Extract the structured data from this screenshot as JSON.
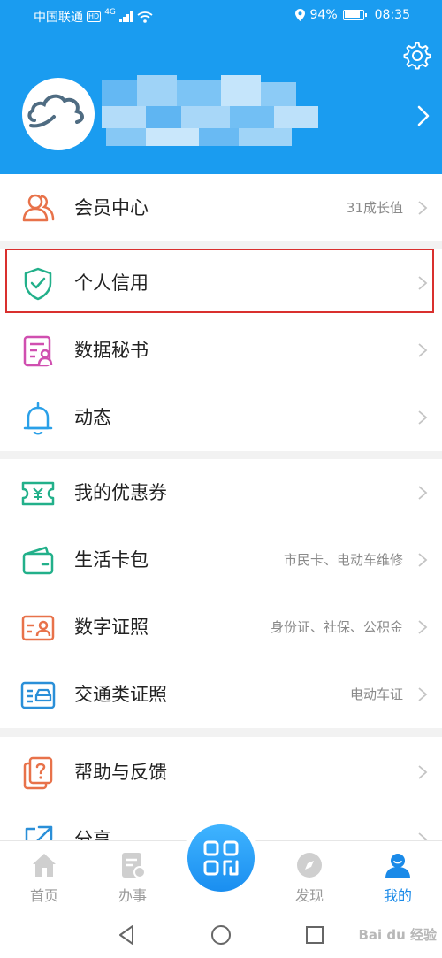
{
  "status_bar": {
    "carrier": "中国联通",
    "network": "4G",
    "battery": "94%",
    "time": "08:35"
  },
  "menu": {
    "group1": [
      {
        "name": "member-center",
        "title": "会员中心",
        "subtitle": "31成长值",
        "icon": "members-icon",
        "color": "#e8724a"
      },
      {
        "name": "personal-credit",
        "title": "个人信用",
        "subtitle": "",
        "icon": "shield-check-icon",
        "color": "#22b08a"
      },
      {
        "name": "data-secretary",
        "title": "数据秘书",
        "subtitle": "",
        "icon": "document-person-icon",
        "color": "#d04fb0"
      },
      {
        "name": "activity",
        "title": "动态",
        "subtitle": "",
        "icon": "bell-icon",
        "color": "#2aa0e8"
      }
    ],
    "group2": [
      {
        "name": "my-coupons",
        "title": "我的优惠券",
        "subtitle": "",
        "icon": "coupon-icon",
        "color": "#22b08a"
      },
      {
        "name": "life-wallet",
        "title": "生活卡包",
        "subtitle": "市民卡、电动车维修",
        "icon": "wallet-icon",
        "color": "#22b08a"
      },
      {
        "name": "digital-license",
        "title": "数字证照",
        "subtitle": "身份证、社保、公积金",
        "icon": "id-card-icon",
        "color": "#e8724a"
      },
      {
        "name": "traffic-license",
        "title": "交通类证照",
        "subtitle": "电动车证",
        "icon": "vehicle-card-icon",
        "color": "#2a8fd8"
      }
    ],
    "group3": [
      {
        "name": "help-feedback",
        "title": "帮助与反馈",
        "subtitle": "",
        "icon": "help-icon",
        "color": "#e8724a"
      },
      {
        "name": "share",
        "title": "分享",
        "subtitle": "",
        "icon": "share-icon",
        "color": "#2a8fd8"
      }
    ]
  },
  "tabs": [
    {
      "name": "home",
      "label": "首页",
      "icon": "home-icon"
    },
    {
      "name": "services",
      "label": "办事",
      "icon": "document-edit-icon"
    },
    {
      "name": "discover",
      "label": "发现",
      "icon": "compass-icon"
    },
    {
      "name": "mine",
      "label": "我的",
      "icon": "user-icon",
      "active": true
    }
  ],
  "center_button": {
    "icon": "scan-grid-icon"
  },
  "watermark": "Bai du 经验",
  "colors": {
    "header_blue": "#1a9cf0",
    "active_blue": "#1a8ae8",
    "highlight_red": "#d9302e"
  }
}
